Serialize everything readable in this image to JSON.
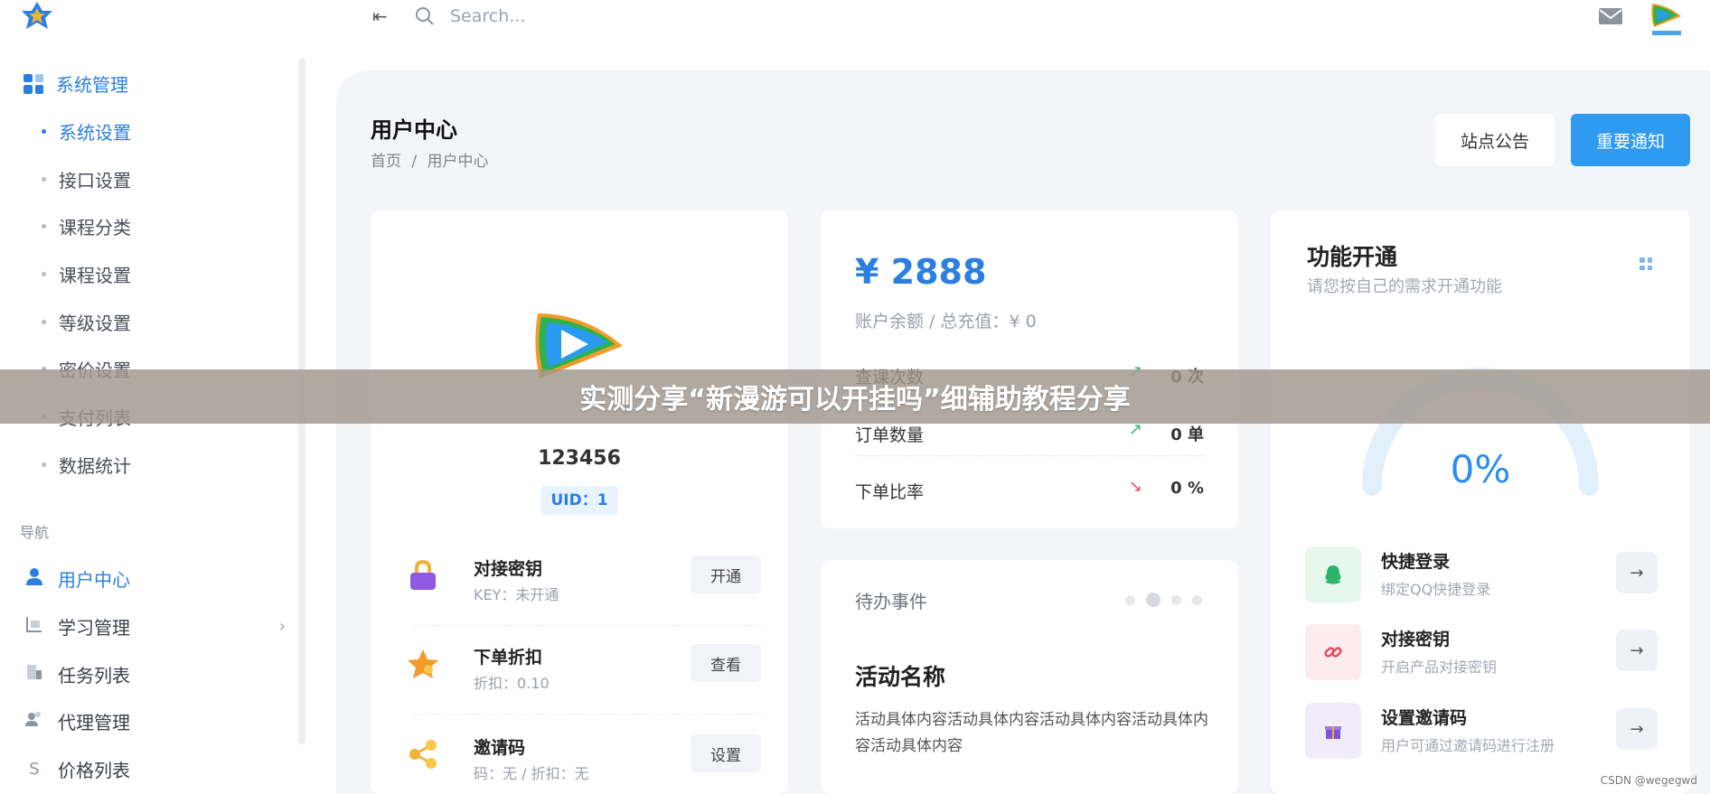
{
  "header": {
    "search_placeholder": "Search...",
    "collapse_glyph": "⇤"
  },
  "sidebar": {
    "group_label": "系统管理",
    "sub_items": [
      {
        "label": "系统设置",
        "active": true
      },
      {
        "label": "接口设置"
      },
      {
        "label": "课程分类"
      },
      {
        "label": "课程设置"
      },
      {
        "label": "等级设置"
      },
      {
        "label": "密价设置"
      },
      {
        "label": "支付列表"
      },
      {
        "label": "数据统计"
      }
    ],
    "nav_heading": "导航",
    "nav_items": [
      {
        "label": "用户中心",
        "icon": "user-icon",
        "active": true
      },
      {
        "label": "学习管理",
        "icon": "learning-icon",
        "has_chevron": true
      },
      {
        "label": "任务列表",
        "icon": "task-icon"
      },
      {
        "label": "代理管理",
        "icon": "agents-icon"
      },
      {
        "label": "价格列表",
        "icon": "price-icon",
        "icon_text": "S"
      }
    ],
    "chevron": "›"
  },
  "page": {
    "title": "用户中心",
    "breadcrumb": [
      "首页",
      "/",
      "用户中心"
    ],
    "notice_button": "站点公告",
    "important_button": "重要通知"
  },
  "profile": {
    "username": "123456",
    "uid": "UID：1",
    "features": [
      {
        "title": "对接密钥",
        "sub": "KEY：未开通",
        "button": "开通",
        "icon": "lock-icon"
      },
      {
        "title": "下单折扣",
        "sub": "折扣：0.10",
        "button": "查看",
        "icon": "star-icon"
      },
      {
        "title": "邀请码",
        "sub": "码：无 / 折扣：无",
        "button": "设置",
        "icon": "share-icon"
      }
    ]
  },
  "balance": {
    "amount": "¥ 2888",
    "sub": "账户余额 / 总充值：¥ 0",
    "stats": [
      {
        "label": "查课次数",
        "value": "0 次",
        "trend": "up"
      },
      {
        "label": "订单数量",
        "value": "0 单",
        "trend": "up"
      },
      {
        "label": "下单比率",
        "value": "0 %",
        "trend": "down"
      }
    ],
    "trend_up_glyph": "↗",
    "trend_down_glyph": "↘"
  },
  "todo": {
    "title": "待办事件",
    "activity_title": "活动名称",
    "activity_body": "活动具体内容活动具体内容活动具体内容活动具体内容活动具体内容"
  },
  "functions": {
    "title": "功能开通",
    "sub": "请您按自己的需求开通功能",
    "gauge_value": "0%",
    "gauge_fraction": 0,
    "rows": [
      {
        "title": "快捷登录",
        "sub": "绑定QQ快捷登录",
        "icon": "qq-icon",
        "bg": "#e6f7ee"
      },
      {
        "title": "对接密钥",
        "sub": "开启产品对接密钥",
        "icon": "link-icon",
        "bg": "#fdecef"
      },
      {
        "title": "设置邀请码",
        "sub": "用户可通过邀请码进行注册",
        "icon": "gift-icon",
        "bg": "#f0ecfb"
      }
    ],
    "arrow": "→"
  },
  "banner": {
    "text": "实测分享“新漫游可以开挂吗”细辅助教程分享"
  },
  "watermark": "CSDN @wegegwd",
  "colors": {
    "accent": "#2a7fe0",
    "primary_button": "#2e9bf0",
    "trend_up": "#34b27a",
    "trend_down": "#e74c5a"
  }
}
